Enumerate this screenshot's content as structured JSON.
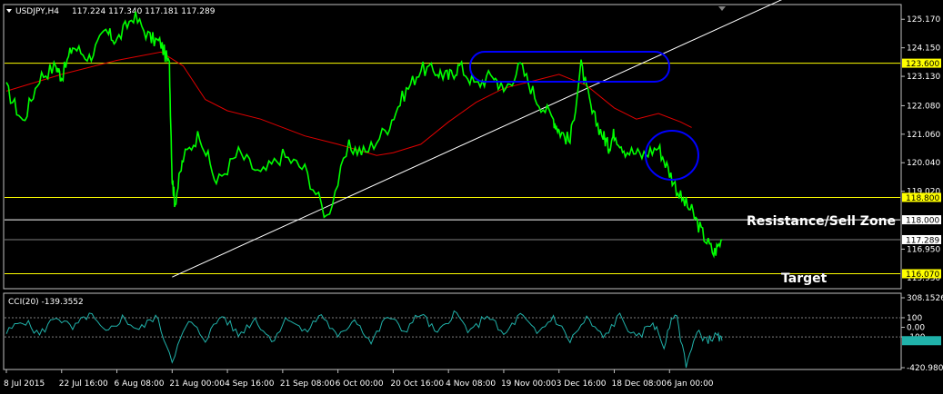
{
  "symbol_header": {
    "symbol": "USDJPY,H4",
    "ohlc": "117.224 117.340 117.181 117.289"
  },
  "colors": {
    "background": "#000000",
    "frame": "#c0c0c0",
    "price_line": "#00ff00",
    "moving_average": "#ff0000",
    "trendline": "#ffffff",
    "horizontal_levels": "#ffff00",
    "bid_line": "#808080",
    "cci": "#20b2aa",
    "ellipse": "#0000ff",
    "label_box_yellow": "#ffff00",
    "label_box_white": "#ffffff"
  },
  "annotations": {
    "resistance_label": "Resistance/Sell Zone",
    "target_label": "Target"
  },
  "main_panel": {
    "y_ticks": [
      "125.170",
      "124.150",
      "123.130",
      "122.080",
      "121.060",
      "120.040",
      "119.020",
      "116.950"
    ],
    "level_labels": [
      {
        "text": "123.600",
        "value": 123.6,
        "box": "yellow"
      },
      {
        "text": "118.800",
        "value": 118.8,
        "box": "yellow"
      },
      {
        "text": "118.000",
        "value": 118.0,
        "box": "white"
      },
      {
        "text": "117.289",
        "value": 117.289,
        "box": "white"
      },
      {
        "text": "116.070",
        "value": 116.07,
        "box": "yellow"
      }
    ],
    "overlapping_tick_text": "115.930"
  },
  "cci_panel": {
    "title": "CCI(20) -139.3552",
    "y_ticks": [
      "308.1526",
      "100",
      "0.00",
      "-100",
      "-420.9801"
    ],
    "levels": [
      100,
      -100
    ]
  },
  "x_labels": [
    "8 Jul 2015",
    "22 Jul 16:00",
    "6 Aug 08:00",
    "21 Aug 00:00",
    "4 Sep 16:00",
    "21 Sep 08:00",
    "6 Oct 00:00",
    "20 Oct 16:00",
    "4 Nov 08:00",
    "19 Nov 00:00",
    "3 Dec 16:00",
    "18 Dec 08:00",
    "6 Jan 00:00"
  ],
  "chart_data": {
    "type": "line",
    "title": "USDJPY,H4",
    "x": [
      "8 Jul 2015",
      "22 Jul 16:00",
      "6 Aug 08:00",
      "21 Aug 00:00",
      "4 Sep 16:00",
      "21 Sep 08:00",
      "6 Oct 00:00",
      "20 Oct 16:00",
      "4 Nov 08:00",
      "19 Nov 00:00",
      "3 Dec 16:00",
      "18 Dec 08:00",
      "6 Jan 00:00"
    ],
    "ylim": [
      115.6,
      125.6
    ],
    "series": [
      {
        "x": [
          0,
          0.3,
          0.6,
          0.9,
          1.0,
          1.2,
          1.5,
          1.8,
          2.0,
          2.3,
          2.6,
          2.8,
          2.95,
          3.0,
          3.05,
          3.2,
          3.5,
          3.8,
          4.2,
          4.6,
          5.0,
          5.4,
          5.8,
          6.2,
          6.5,
          6.9,
          7.2,
          7.5,
          7.8,
          8.0,
          8.2,
          8.5,
          8.8,
          9.0,
          9.3,
          9.6,
          9.9,
          10.0,
          10.2,
          10.4,
          10.6,
          10.8,
          10.9,
          11.0,
          11.2,
          11.5,
          11.8,
          12.0,
          12.2,
          12.4,
          12.6,
          12.8,
          12.95
        ],
        "values": [
          122.7,
          121.5,
          123.1,
          123.5,
          123.1,
          124.2,
          123.8,
          124.7,
          124.4,
          125.3,
          124.5,
          124.3,
          123.5,
          119.5,
          118.6,
          120.2,
          121.1,
          119.3,
          120.4,
          119.6,
          120.3,
          119.8,
          118.1,
          120.6,
          120.4,
          121.3,
          122.5,
          123.4,
          123.3,
          123.1,
          123.5,
          122.8,
          123.2,
          122.6,
          123.5,
          122.3,
          121.6,
          121.2,
          120.8,
          123.5,
          121.8,
          121.0,
          120.6,
          121.1,
          120.5,
          120.3,
          120.6,
          119.7,
          118.8,
          118.3,
          117.5,
          116.8,
          117.29
        ]
      },
      {
        "x": [
          0,
          1.0,
          2.0,
          2.8,
          3.2,
          3.6,
          4.0,
          4.6,
          5.4,
          6.0,
          6.7,
          7.0,
          7.5,
          8.0,
          8.5,
          9.0,
          9.6,
          10.0,
          10.5,
          11.0,
          11.4,
          11.8,
          12.2,
          12.4
        ],
        "values": [
          122.6,
          123.2,
          123.7,
          124.0,
          123.5,
          122.3,
          121.9,
          121.6,
          121.0,
          120.7,
          120.3,
          120.4,
          120.7,
          121.5,
          122.2,
          122.7,
          123.0,
          123.2,
          122.8,
          122.0,
          121.6,
          121.8,
          121.5,
          121.3
        ]
      }
    ],
    "trendline": {
      "x": [
        3.0,
        12.95
      ],
      "values": [
        115.95,
        124.9
      ]
    },
    "cci": {
      "ylim": [
        -420.9801,
        308.1526
      ],
      "x": [
        0,
        0.3,
        0.6,
        0.9,
        1.2,
        1.5,
        1.8,
        2.1,
        2.4,
        2.7,
        3.0,
        3.3,
        3.6,
        3.9,
        4.2,
        4.5,
        4.8,
        5.1,
        5.4,
        5.7,
        6.0,
        6.3,
        6.6,
        6.9,
        7.2,
        7.5,
        7.8,
        8.1,
        8.4,
        8.7,
        9.0,
        9.3,
        9.6,
        9.9,
        10.2,
        10.5,
        10.8,
        11.1,
        11.4,
        11.7,
        11.9,
        12.1,
        12.3,
        12.5,
        12.7,
        12.85,
        12.95
      ],
      "values": [
        -60,
        80,
        -80,
        120,
        -20,
        140,
        -70,
        100,
        -30,
        120,
        -330,
        60,
        -120,
        130,
        -80,
        90,
        -140,
        110,
        -60,
        140,
        -120,
        100,
        -160,
        120,
        -40,
        150,
        -80,
        160,
        -60,
        140,
        -90,
        130,
        -70,
        110,
        -140,
        90,
        -110,
        120,
        -130,
        60,
        -200,
        170,
        -380,
        -60,
        -130,
        -90,
        -139.36
      ]
    }
  }
}
